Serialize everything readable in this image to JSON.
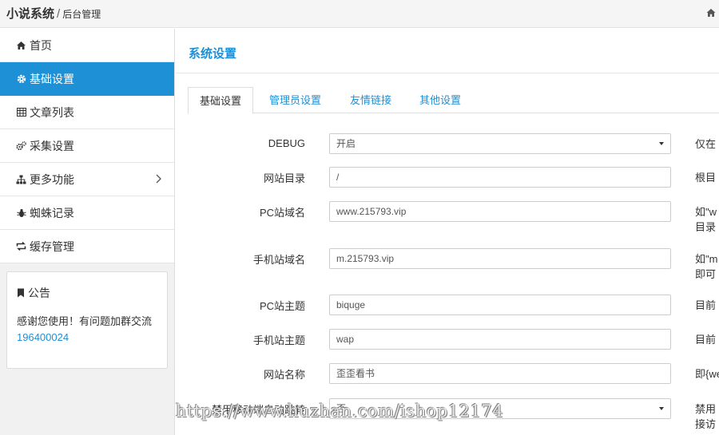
{
  "header": {
    "brand": "小说系统",
    "separator": "/",
    "subtitle": "后台管理"
  },
  "sidebar": {
    "items": [
      {
        "label": "首页",
        "icon": "home-icon"
      },
      {
        "label": "基础设置",
        "icon": "gear-icon",
        "active": true
      },
      {
        "label": "文章列表",
        "icon": "table-icon"
      },
      {
        "label": "采集设置",
        "icon": "gears-icon"
      },
      {
        "label": "更多功能",
        "icon": "sitemap-icon"
      },
      {
        "label": "蜘蛛记录",
        "icon": "bug-icon"
      },
      {
        "label": "缓存管理",
        "icon": "refresh-icon"
      }
    ],
    "notice": {
      "title": "公告",
      "text": "感谢您使用！有问题加群交流",
      "group_number": "196400024"
    }
  },
  "main": {
    "title": "系统设置",
    "tabs": [
      {
        "label": "基础设置",
        "active": true
      },
      {
        "label": "管理员设置"
      },
      {
        "label": "友情链接"
      },
      {
        "label": "其他设置"
      }
    ],
    "form": [
      {
        "label": "DEBUG",
        "type": "select",
        "value": "开启",
        "hint": [
          "仅在"
        ]
      },
      {
        "label": "网站目录",
        "type": "input",
        "value": "/",
        "hint": [
          "根目"
        ]
      },
      {
        "label": "PC站域名",
        "type": "input",
        "value": "www.215793.vip",
        "hint": [
          "如\"w",
          "目录"
        ]
      },
      {
        "label": "手机站域名",
        "type": "input",
        "value": "m.215793.vip",
        "hint": [
          "如\"m",
          "即可"
        ]
      },
      {
        "label": "PC站主题",
        "type": "input",
        "value": "biquge",
        "hint": [
          "目前"
        ]
      },
      {
        "label": "手机站主题",
        "type": "input",
        "value": "wap",
        "hint": [
          "目前"
        ]
      },
      {
        "label": "网站名称",
        "type": "input",
        "value": "歪歪看书",
        "hint": [
          "即{we"
        ]
      },
      {
        "label": "禁用移动端自动跳转",
        "type": "select",
        "value": "否",
        "hint": [
          "禁用",
          "接访"
        ]
      }
    ]
  },
  "watermark": "https://www.huzhan.com/ishop12174",
  "colors": {
    "accent": "#1e90d6",
    "sidebar_bg": "#f1f1f1",
    "topbar_bg": "#f5f5f5"
  }
}
